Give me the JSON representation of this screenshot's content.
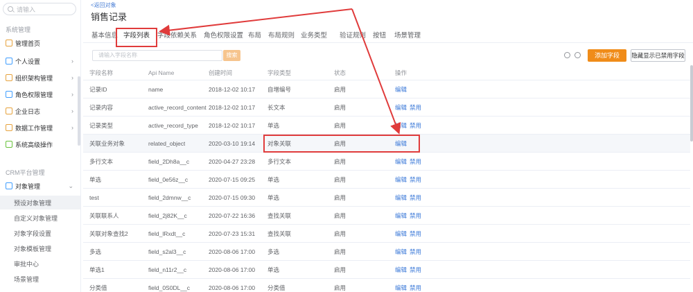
{
  "sidebar": {
    "search_placeholder": "请输入",
    "group1": "系统管理",
    "items": [
      {
        "label": "管理首页",
        "chev": ""
      },
      {
        "label": "个人设置",
        "chev": "›"
      },
      {
        "label": "组织架构管理",
        "chev": "›"
      },
      {
        "label": "角色权限管理",
        "chev": "›"
      },
      {
        "label": "企业日志",
        "chev": "›"
      },
      {
        "label": "数据工作管理",
        "chev": "›"
      },
      {
        "label": "系统高级操作",
        "chev": ""
      }
    ],
    "group2": "CRM平台管理",
    "object_mgmt": {
      "label": "对象管理",
      "chev": "⌄"
    },
    "sub_items": [
      "预设对象管理",
      "自定义对象管理",
      "对象字段设置",
      "对象模板管理",
      "审批中心",
      "场景管理"
    ]
  },
  "header": {
    "back": "<返回对象",
    "title": "销售记录"
  },
  "tabs": [
    "基本信息",
    "字段列表",
    "字段依赖关系",
    "角色权限设置",
    "布局",
    "布局规则",
    "业务类型",
    "验证规则",
    "按钮",
    "场景管理"
  ],
  "toolbar": {
    "search_placeholder": "请输入字段名称",
    "search_btn": "搜索",
    "add_btn": "添加字段",
    "hide_btn": "隐藏显示已禁用字段"
  },
  "table": {
    "columns": [
      "字段名称",
      "Api Name",
      "创建时间",
      "字段类型",
      "状态",
      "操作"
    ],
    "rows": [
      {
        "name": "记录ID",
        "api": "name",
        "time": "2018-12-02 10:17",
        "type": "自增编号",
        "status": "启用",
        "ops": [
          "编辑"
        ]
      },
      {
        "name": "记录内容",
        "api": "active_record_content",
        "time": "2018-12-02 10:17",
        "type": "长文本",
        "status": "启用",
        "ops": [
          "编辑",
          "禁用"
        ]
      },
      {
        "name": "记录类型",
        "api": "active_record_type",
        "time": "2018-12-02 10:17",
        "type": "单选",
        "status": "启用",
        "ops": [
          "编辑",
          "禁用"
        ]
      },
      {
        "name": "关联业务对象",
        "api": "related_object",
        "time": "2020-03-10 19:14",
        "type": "对象关联",
        "status": "启用",
        "ops": [
          "编辑"
        ]
      },
      {
        "name": "多行文本",
        "api": "field_2Dh8a__c",
        "time": "2020-04-27 23:28",
        "type": "多行文本",
        "status": "启用",
        "ops": [
          "编辑",
          "禁用"
        ]
      },
      {
        "name": "单选",
        "api": "field_0e56z__c",
        "time": "2020-07-15 09:25",
        "type": "单选",
        "status": "启用",
        "ops": [
          "编辑",
          "禁用"
        ]
      },
      {
        "name": "test",
        "api": "field_2dmnw__c",
        "time": "2020-07-15 09:30",
        "type": "单选",
        "status": "启用",
        "ops": [
          "编辑",
          "禁用"
        ]
      },
      {
        "name": "关联联系人",
        "api": "field_2j82K__c",
        "time": "2020-07-22 16:36",
        "type": "查找关联",
        "status": "启用",
        "ops": [
          "编辑",
          "禁用"
        ]
      },
      {
        "name": "关联对象查找2",
        "api": "field_lRxdt__c",
        "time": "2020-07-23 15:31",
        "type": "查找关联",
        "status": "启用",
        "ops": [
          "编辑",
          "禁用"
        ]
      },
      {
        "name": "多选",
        "api": "field_s2al3__c",
        "time": "2020-08-06 17:00",
        "type": "多选",
        "status": "启用",
        "ops": [
          "编辑",
          "禁用"
        ]
      },
      {
        "name": "单选1",
        "api": "field_n11r2__c",
        "time": "2020-08-06 17:00",
        "type": "单选",
        "status": "启用",
        "ops": [
          "编辑",
          "禁用"
        ]
      },
      {
        "name": "分类值",
        "api": "field_0S0DL__c",
        "time": "2020-08-06 17:00",
        "type": "分类值",
        "status": "启用",
        "ops": [
          "编辑",
          "禁用"
        ]
      }
    ]
  }
}
